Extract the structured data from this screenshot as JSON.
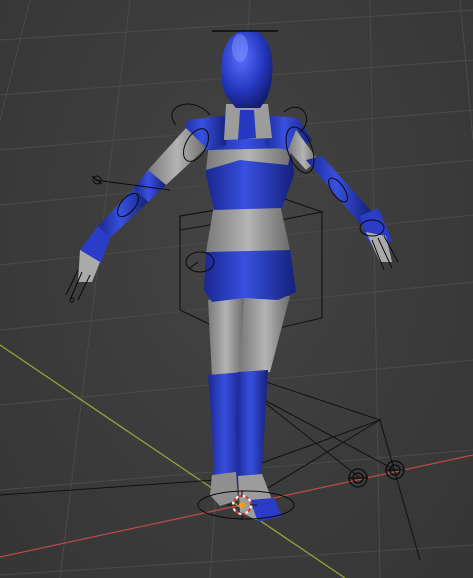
{
  "viewport": {
    "kind": "3d-viewport",
    "background_color": "#3c3c3c",
    "grid_color": "#4a4a4a",
    "axis_x_color": "#b94a4a",
    "axis_y_color": "#8fa53a"
  },
  "model": {
    "kind": "rigged-female-character",
    "pose": "A-pose",
    "primary_color": "#2233bb",
    "secondary_color": "#9a9a9a",
    "rig_color": "#000000"
  },
  "scene_objects": {
    "origin_marker": "3d-cursor-icon",
    "control_box": "cube-wireframe",
    "ik_targets": "circle-handle-icon"
  }
}
